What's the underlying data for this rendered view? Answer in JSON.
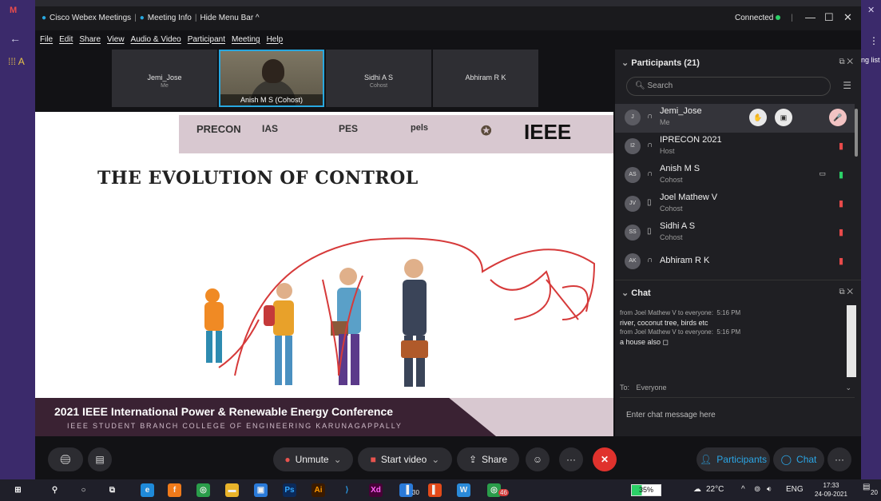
{
  "browser": {
    "gmail_icon": "M",
    "left_grid_label": "A",
    "right_label": "ng list"
  },
  "titlebar": {
    "app": "Cisco Webex Meetings",
    "meeting_info": "Meeting Info",
    "hide_menu": "Hide Menu Bar ^",
    "status": "Connected",
    "min": "—",
    "max": "☐",
    "close": "✕"
  },
  "menu": [
    "File",
    "Edit",
    "Share",
    "View",
    "Audio & Video",
    "Participant",
    "Meeting",
    "Help"
  ],
  "videos": [
    {
      "name": "Jemi_Jose",
      "role": "Me"
    },
    {
      "name": "Anish M S (Cohost)",
      "role": ""
    },
    {
      "name": "Sidhi A S",
      "role": "Cohost"
    },
    {
      "name": "Abhiram R K",
      "role": ""
    }
  ],
  "slide": {
    "title": "THE EVOLUTION OF CONTROL",
    "logos": [
      "PRECON",
      "IAS",
      "PES",
      "pels",
      "IEEE"
    ],
    "conference": "2021 IEEE International Power & Renewable Energy Conference",
    "college": "IEEE STUDENT BRANCH COLLEGE OF ENGINEERING KARUNAGAPPALLY"
  },
  "participants": {
    "header": "Participants (21)",
    "search_placeholder": "Search",
    "list": [
      {
        "initials": "J",
        "name": "Jemi_Jose",
        "role": "Me",
        "mic": "muted"
      },
      {
        "initials": "I2",
        "name": "IPRECON 2021",
        "role": "Host",
        "mic": "muted"
      },
      {
        "initials": "AS",
        "name": "Anish M S",
        "role": "Cohost",
        "mic": "on"
      },
      {
        "initials": "JV",
        "name": "Joel Mathew V",
        "role": "Cohost",
        "mic": "muted"
      },
      {
        "initials": "SS",
        "name": "Sidhi A S",
        "role": "Cohost",
        "mic": "muted"
      },
      {
        "initials": "AK",
        "name": "Abhiram R K",
        "role": "",
        "mic": "muted"
      }
    ]
  },
  "chat": {
    "header": "Chat",
    "messages": [
      {
        "from": "from Joel Mathew V to everyone:",
        "time": "5:16 PM",
        "text": "river, coconut tree, birds etc"
      },
      {
        "from": "from Joel Mathew V to everyone:",
        "time": "5:16 PM",
        "text": "a house also ◻"
      }
    ],
    "to_label": "To:",
    "to_value": "Everyone",
    "input_placeholder": "Enter chat message here"
  },
  "controls": {
    "unmute": "Unmute",
    "start_video": "Start video",
    "share": "Share",
    "participants": "Participants",
    "chat": "Chat",
    "more": "···"
  },
  "taskbar": {
    "battery": "35%",
    "temp": "22°C",
    "lang": "ENG",
    "time": "17:33",
    "date": "24-09-2021",
    "badge1": "30",
    "badge2": "46",
    "notif": "20"
  }
}
